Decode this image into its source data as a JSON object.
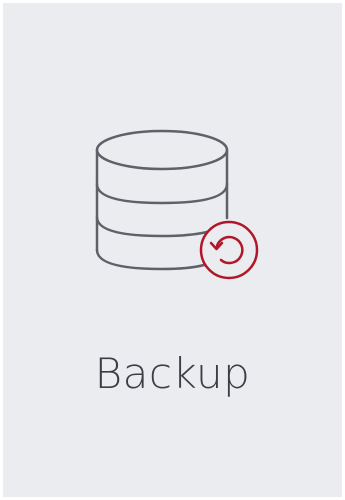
{
  "tile": {
    "label": "Backup",
    "icon": "database-restore-icon",
    "colors": {
      "background": "#ebecf0",
      "icon_stroke": "#5e6268",
      "accent": "#b0182a",
      "text": "#3b3e45"
    }
  }
}
